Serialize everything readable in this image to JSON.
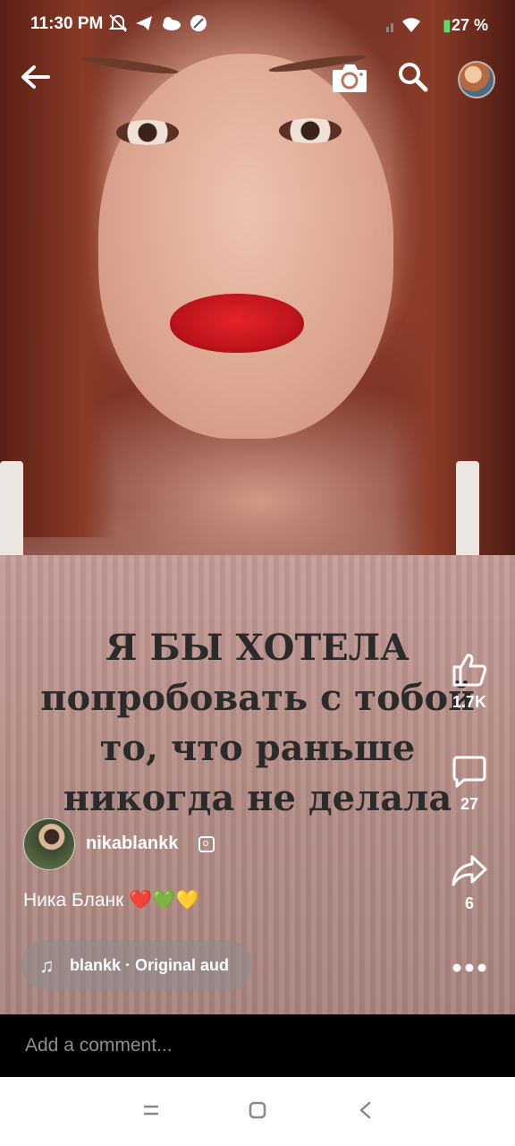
{
  "status_bar": {
    "time": "11:30 PM",
    "battery": "27",
    "battery_suffix": "%"
  },
  "topbar": {
    "back_icon": "arrow-left-icon",
    "camera_icon": "camera-icon",
    "search_icon": "search-icon"
  },
  "video": {
    "overlay_lines": [
      "Я БЫ ХОТЕЛА",
      "попробовать с тобой",
      "то, что раньше",
      "никогда не делала"
    ]
  },
  "actions": {
    "likes": "1.7K",
    "comments": "27",
    "shares": "6"
  },
  "post": {
    "username": "nikablankk",
    "caption": "Ника Бланк ❤️💚💛",
    "audio": "blankk · Original aud"
  },
  "comment": {
    "placeholder": "Add a comment..."
  },
  "colors": {
    "comment_bar": "#000000",
    "navbar": "#ffffff",
    "battery": "#57e06e"
  }
}
